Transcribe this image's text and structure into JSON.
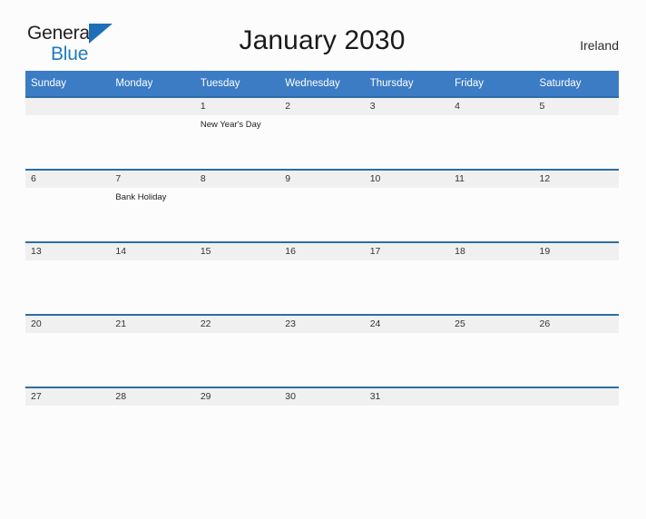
{
  "brand": {
    "name_part1": "General",
    "name_part2": "Blue",
    "flag_icon": "triangle-flag-icon",
    "color_dark": "#231f20",
    "color_blue": "#1f7ac0"
  },
  "header": {
    "title": "January 2030",
    "region": "Ireland"
  },
  "theme": {
    "header_blue": "#3b7cc4",
    "rule_blue": "#2e6da4",
    "date_band": "#f0f0f0",
    "page_background": "#fcfcfd"
  },
  "calendar": {
    "month": "January",
    "year": "2030",
    "weekday_headers": [
      "Sunday",
      "Monday",
      "Tuesday",
      "Wednesday",
      "Thursday",
      "Friday",
      "Saturday"
    ],
    "weeks": [
      [
        {
          "date": "",
          "event": ""
        },
        {
          "date": "",
          "event": ""
        },
        {
          "date": "1",
          "event": "New Year's Day"
        },
        {
          "date": "2",
          "event": ""
        },
        {
          "date": "3",
          "event": ""
        },
        {
          "date": "4",
          "event": ""
        },
        {
          "date": "5",
          "event": ""
        }
      ],
      [
        {
          "date": "6",
          "event": ""
        },
        {
          "date": "7",
          "event": "Bank Holiday"
        },
        {
          "date": "8",
          "event": ""
        },
        {
          "date": "9",
          "event": ""
        },
        {
          "date": "10",
          "event": ""
        },
        {
          "date": "11",
          "event": ""
        },
        {
          "date": "12",
          "event": ""
        }
      ],
      [
        {
          "date": "13",
          "event": ""
        },
        {
          "date": "14",
          "event": ""
        },
        {
          "date": "15",
          "event": ""
        },
        {
          "date": "16",
          "event": ""
        },
        {
          "date": "17",
          "event": ""
        },
        {
          "date": "18",
          "event": ""
        },
        {
          "date": "19",
          "event": ""
        }
      ],
      [
        {
          "date": "20",
          "event": ""
        },
        {
          "date": "21",
          "event": ""
        },
        {
          "date": "22",
          "event": ""
        },
        {
          "date": "23",
          "event": ""
        },
        {
          "date": "24",
          "event": ""
        },
        {
          "date": "25",
          "event": ""
        },
        {
          "date": "26",
          "event": ""
        }
      ],
      [
        {
          "date": "27",
          "event": ""
        },
        {
          "date": "28",
          "event": ""
        },
        {
          "date": "29",
          "event": ""
        },
        {
          "date": "30",
          "event": ""
        },
        {
          "date": "31",
          "event": ""
        },
        {
          "date": "",
          "event": ""
        },
        {
          "date": "",
          "event": ""
        }
      ]
    ]
  }
}
